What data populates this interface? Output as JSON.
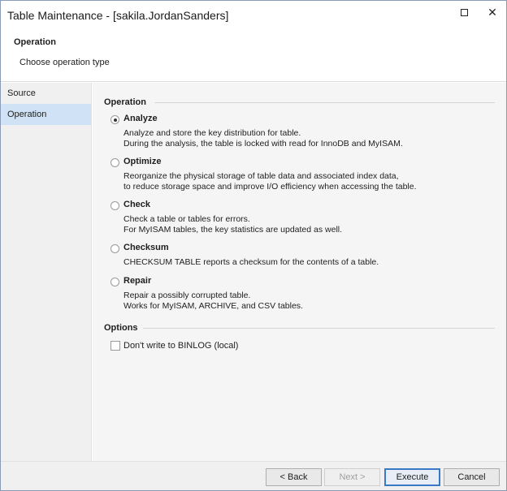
{
  "window": {
    "title": "Table Maintenance - [sakila.JordanSanders]"
  },
  "header": {
    "title": "Operation",
    "subtitle": "Choose operation type"
  },
  "sidebar": {
    "items": [
      {
        "label": "Source"
      },
      {
        "label": "Operation"
      }
    ]
  },
  "operation_section": {
    "title": "Operation",
    "options": [
      {
        "label": "Analyze",
        "selected": true,
        "desc1": "Analyze and store the key distribution for table.",
        "desc2": "During the analysis, the table is locked with read for InnoDB and MyISAM."
      },
      {
        "label": "Optimize",
        "selected": false,
        "desc1": "Reorganize the physical storage of table data and associated index data,",
        "desc2": "to reduce storage space and improve I/O efficiency when accessing the table."
      },
      {
        "label": "Check",
        "selected": false,
        "desc1": "Check a table or tables for errors.",
        "desc2": "For MyISAM tables, the key statistics are updated as well."
      },
      {
        "label": "Checksum",
        "selected": false,
        "desc1": "CHECKSUM TABLE reports a checksum for the contents of a table.",
        "desc2": ""
      },
      {
        "label": "Repair",
        "selected": false,
        "desc1": "Repair a possibly corrupted table.",
        "desc2": "Works for MyISAM, ARCHIVE, and CSV tables."
      }
    ]
  },
  "options_section": {
    "title": "Options",
    "binlog_label": "Don't write to BINLOG (local)",
    "binlog_checked": false
  },
  "footer": {
    "back": "< Back",
    "next": "Next >",
    "execute": "Execute",
    "cancel": "Cancel"
  }
}
